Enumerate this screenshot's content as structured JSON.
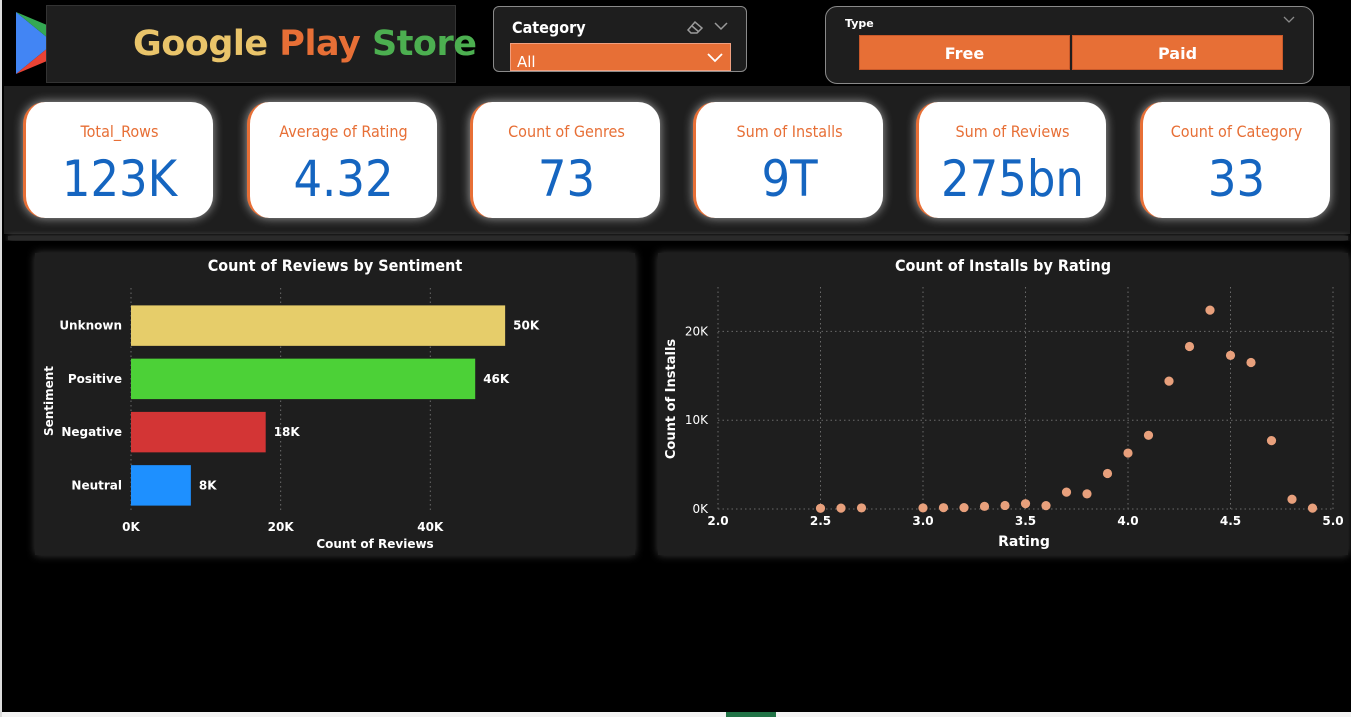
{
  "header": {
    "title_parts": [
      "Google",
      " Play",
      " Store"
    ],
    "colors": {
      "google": "#e9c46a",
      "play": "#e76f36",
      "store": "#4caf50"
    },
    "logo_icon": "play-store-logo-icon"
  },
  "slicers": {
    "category": {
      "title": "Category",
      "value": "All",
      "clear_icon": "eraser-icon",
      "expand_icon": "chevron-down-icon"
    },
    "type": {
      "title": "Type",
      "options": [
        "Free",
        "Paid"
      ],
      "expand_icon": "chevron-down-icon"
    }
  },
  "kpis": [
    {
      "label": "Total_Rows",
      "value": "123K"
    },
    {
      "label": "Average of Rating",
      "value": "4.32"
    },
    {
      "label": "Count of Genres",
      "value": "73"
    },
    {
      "label": "Sum of Installs",
      "value": "9T"
    },
    {
      "label": "Sum of Reviews",
      "value": "275bn"
    },
    {
      "label": "Count of Category",
      "value": "33"
    }
  ],
  "chart_data": [
    {
      "type": "bar",
      "orientation": "horizontal",
      "title": "Count of Reviews by Sentiment",
      "xlabel": "Count of Reviews",
      "ylabel": "Sentiment",
      "categories": [
        "Unknown",
        "Positive",
        "Negative",
        "Neutral"
      ],
      "values": [
        50000,
        46000,
        18000,
        8000
      ],
      "data_labels": [
        "50K",
        "46K",
        "18K",
        "8K"
      ],
      "colors": [
        "#e6cd6a",
        "#4cd137",
        "#d33535",
        "#1e90ff"
      ],
      "x_ticks": [
        0,
        20000,
        40000
      ],
      "x_tick_labels": [
        "0K",
        "20K",
        "40K"
      ],
      "xlim": [
        0,
        58000
      ],
      "grid": true
    },
    {
      "type": "scatter",
      "title": "Count of Installs by Rating",
      "xlabel": "Rating",
      "ylabel": "Count of Installs",
      "x_ticks": [
        2.0,
        2.5,
        3.0,
        3.5,
        4.0,
        4.5,
        5.0
      ],
      "x_tick_labels": [
        "2.0",
        "2.5",
        "3.0",
        "3.5",
        "4.0",
        "4.5",
        "5.0"
      ],
      "y_ticks": [
        0,
        10000,
        20000
      ],
      "y_tick_labels": [
        "0K",
        "10K",
        "20K"
      ],
      "xlim": [
        2.0,
        5.0
      ],
      "ylim": [
        0,
        25000
      ],
      "point_color": "#e8a07c",
      "grid": true,
      "points": [
        {
          "x": 2.5,
          "y": 80
        },
        {
          "x": 2.6,
          "y": 100
        },
        {
          "x": 2.7,
          "y": 120
        },
        {
          "x": 3.0,
          "y": 120
        },
        {
          "x": 3.1,
          "y": 150
        },
        {
          "x": 3.2,
          "y": 160
        },
        {
          "x": 3.3,
          "y": 300
        },
        {
          "x": 3.4,
          "y": 400
        },
        {
          "x": 3.5,
          "y": 600
        },
        {
          "x": 3.6,
          "y": 380
        },
        {
          "x": 3.7,
          "y": 1900
        },
        {
          "x": 3.8,
          "y": 1700
        },
        {
          "x": 3.9,
          "y": 4000
        },
        {
          "x": 4.0,
          "y": 6300
        },
        {
          "x": 4.1,
          "y": 8300
        },
        {
          "x": 4.2,
          "y": 14400
        },
        {
          "x": 4.3,
          "y": 18300
        },
        {
          "x": 4.4,
          "y": 22400
        },
        {
          "x": 4.5,
          "y": 17300
        },
        {
          "x": 4.6,
          "y": 16500
        },
        {
          "x": 4.7,
          "y": 7700
        },
        {
          "x": 4.8,
          "y": 1100
        },
        {
          "x": 4.9,
          "y": 100
        }
      ]
    }
  ]
}
